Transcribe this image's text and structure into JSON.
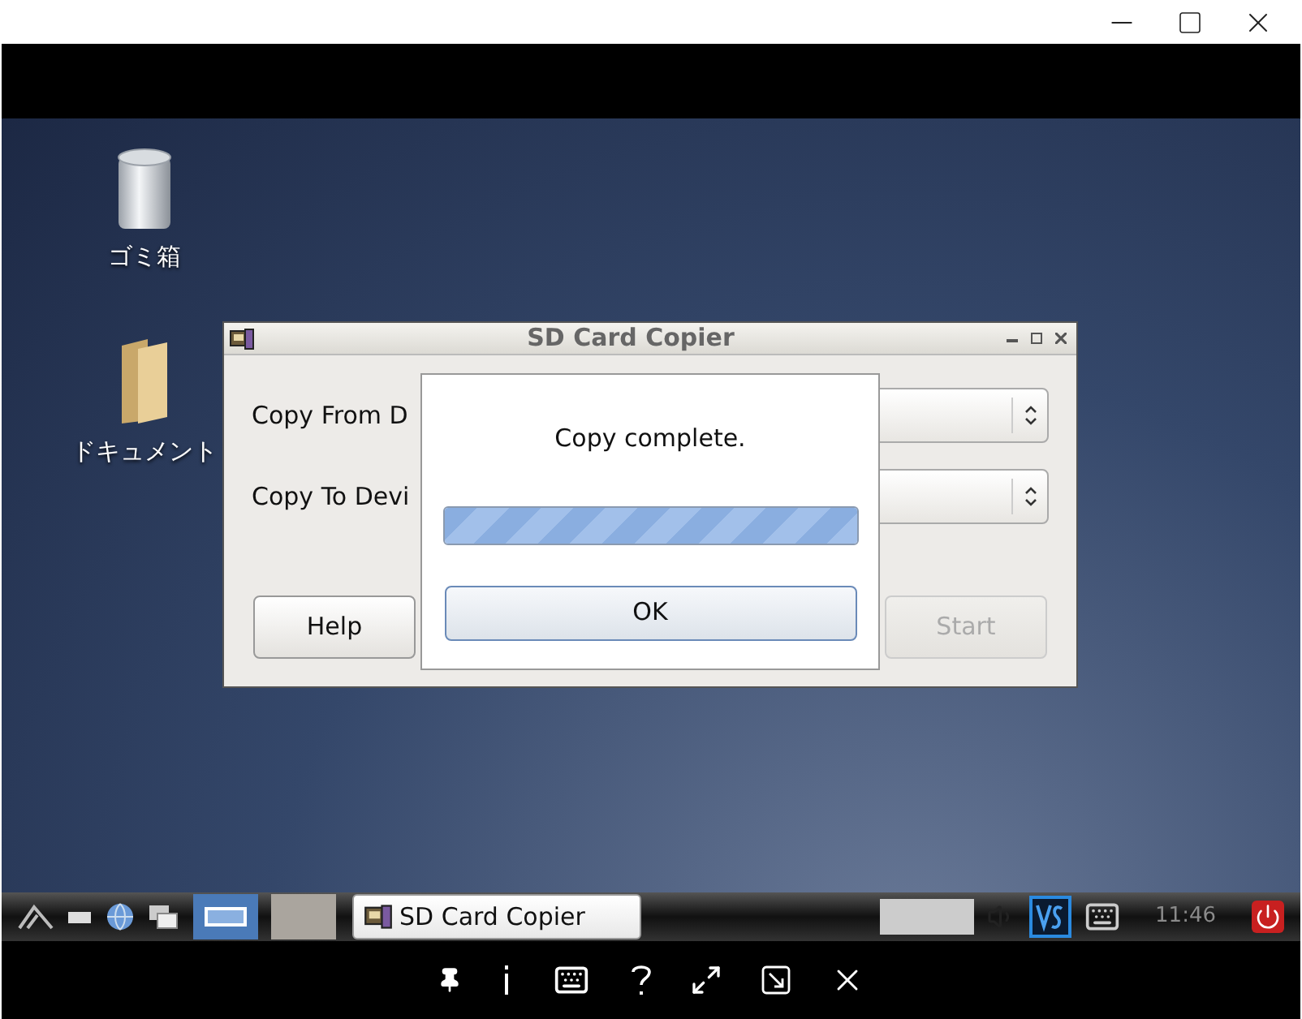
{
  "desktop_icons": [
    {
      "label": "ゴミ箱",
      "kind": "trash"
    },
    {
      "label": "ドキュメント",
      "kind": "folder"
    }
  ],
  "dialog": {
    "title": "SD Card Copier",
    "fields": [
      {
        "label": "Copy From D"
      },
      {
        "label": "Copy To Devi"
      }
    ],
    "buttons": [
      {
        "label": "Help",
        "disabled": false
      },
      {
        "label": "Start",
        "disabled": true
      }
    ]
  },
  "message_box": {
    "text": "Copy complete.",
    "progress": {
      "level": 1
    },
    "button": "OK"
  },
  "taskbar": {
    "workspaces": [
      {
        "selected": true
      },
      {
        "selected": false
      }
    ],
    "task": {
      "label": "SD Card Copier"
    },
    "clock": "11:46"
  }
}
